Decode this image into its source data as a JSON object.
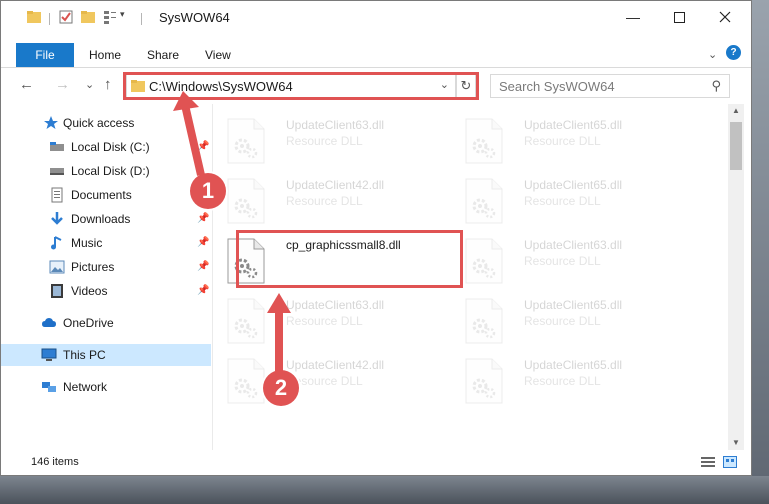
{
  "window": {
    "title": "SysWOW64"
  },
  "ribbon": {
    "tabs": [
      {
        "label": "File",
        "active": true
      },
      {
        "label": "Home"
      },
      {
        "label": "Share"
      },
      {
        "label": "View"
      }
    ],
    "help_label": "?"
  },
  "nav": {
    "back_glyph": "←",
    "forward_glyph": "→",
    "recent_glyph": "⌄",
    "up_glyph": "↑",
    "address": "C:\\Windows\\SysWOW64",
    "refresh_glyph": "↻",
    "search_placeholder": "Search SysWOW64"
  },
  "sidebar": {
    "items": [
      {
        "label": "Quick access",
        "icon": "star-icon",
        "pinned": false
      },
      {
        "label": "Local Disk (C:)",
        "icon": "drive-icon",
        "pinned": true
      },
      {
        "label": "Local Disk (D:)",
        "icon": "drive-icon",
        "pinned": false
      },
      {
        "label": "Documents",
        "icon": "documents-icon",
        "pinned": true
      },
      {
        "label": "Downloads",
        "icon": "download-icon",
        "pinned": true
      },
      {
        "label": "Music",
        "icon": "music-icon",
        "pinned": true
      },
      {
        "label": "Pictures",
        "icon": "pictures-icon",
        "pinned": true
      },
      {
        "label": "Videos",
        "icon": "videos-icon",
        "pinned": true
      },
      {
        "label": "OneDrive",
        "icon": "cloud-icon",
        "pinned": false
      },
      {
        "label": "This PC",
        "icon": "computer-icon",
        "pinned": false,
        "selected": true
      },
      {
        "label": "Network",
        "icon": "network-icon",
        "pinned": false
      }
    ],
    "pin_glyph": "📌"
  },
  "files": [
    {
      "name": "UpdateClient63.dll",
      "type": "Resource DLL",
      "faded": true
    },
    {
      "name": "UpdateClient65.dll",
      "type": "Resource DLL",
      "faded": true
    },
    {
      "name": "UpdateClient42.dll",
      "type": "Resource DLL",
      "faded": true
    },
    {
      "name": "UpdateClient65.dll",
      "type": "Resource DLL",
      "faded": true
    },
    {
      "name": "cp_graphicssmall8.dll",
      "type": "",
      "faded": false
    },
    {
      "name": "UpdateClient63.dll",
      "type": "Resource DLL",
      "faded": true
    },
    {
      "name": "UpdateClient63.dll",
      "type": "Resource DLL",
      "faded": true
    },
    {
      "name": "UpdateClient65.dll",
      "type": "Resource DLL",
      "faded": true
    },
    {
      "name": "UpdateClient42.dll",
      "type": "Resource DLL",
      "faded": true
    },
    {
      "name": "UpdateClient65.dll",
      "type": "Resource DLL",
      "faded": true
    }
  ],
  "status": {
    "item_count": "146 items"
  },
  "annotations": {
    "step1": "1",
    "step2": "2"
  },
  "colors": {
    "accent": "#1979ca",
    "annotation": "#e05353",
    "selection": "#cce8ff"
  }
}
